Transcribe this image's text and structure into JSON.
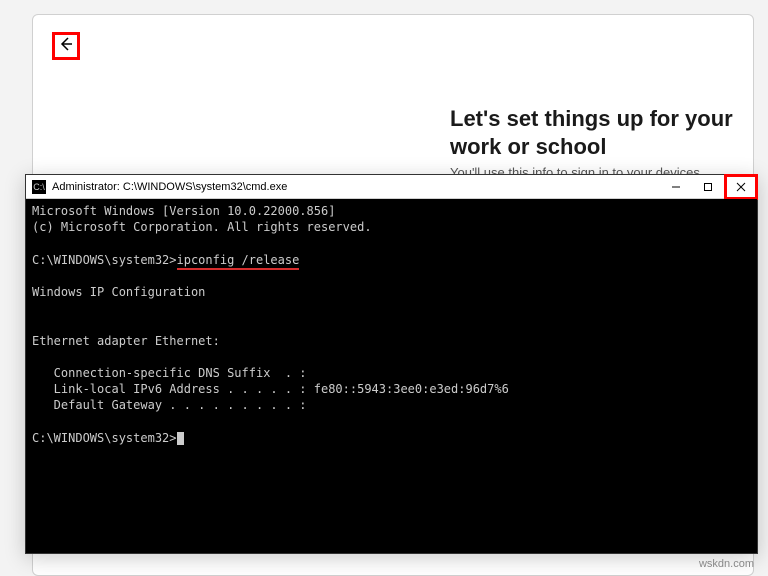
{
  "setup": {
    "heading": "Let's set things up for your work or school",
    "subtext": "You'll use this info to sign in to your devices."
  },
  "cmd": {
    "icon_label": "C:\\",
    "title": "Administrator: C:\\WINDOWS\\system32\\cmd.exe",
    "lines": {
      "ver": "Microsoft Windows [Version 10.0.22000.856]",
      "copyright": "(c) Microsoft Corporation. All rights reserved.",
      "prompt1_path": "C:\\WINDOWS\\system32>",
      "prompt1_cmd": "ipconfig /release",
      "wipc": "Windows IP Configuration",
      "adapter": "Ethernet adapter Ethernet:",
      "dns": "   Connection-specific DNS Suffix  . :",
      "ipv6": "   Link-local IPv6 Address . . . . . : fe80::5943:3ee0:e3ed:96d7%6",
      "gw": "   Default Gateway . . . . . . . . . :",
      "prompt2": "C:\\WINDOWS\\system32>"
    }
  },
  "watermark": "wskdn.com"
}
